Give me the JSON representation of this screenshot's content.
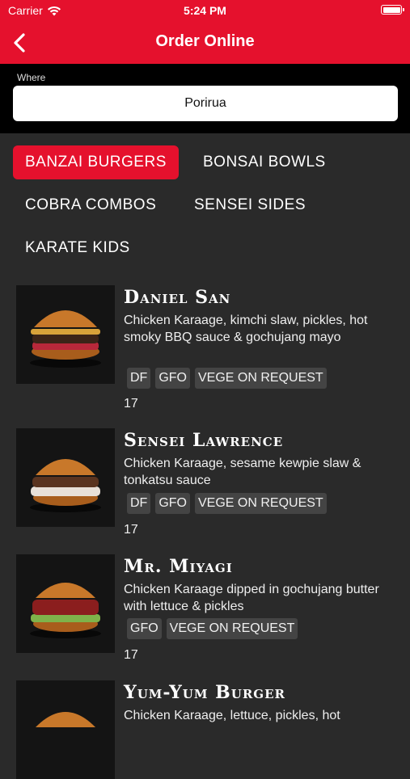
{
  "status_bar": {
    "carrier": "Carrier",
    "time": "5:24 PM"
  },
  "nav": {
    "title": "Order Online"
  },
  "location": {
    "label": "Where",
    "value": "Porirua"
  },
  "categories": [
    "BANZAI BURGERS",
    "BONSAI BOWLS",
    "COBRA COMBOS",
    "SENSEI SIDES",
    "KARATE KIDS"
  ],
  "active_category": "BANZAI BURGERS",
  "colors": {
    "accent": "#e5112d",
    "background": "#2a2a2a",
    "tag": "#444444"
  },
  "items": [
    {
      "name": "Daniel San",
      "description": "Chicken Karaage, kimchi slaw, pickles, hot smoky BBQ sauce & gochujang mayo",
      "tags": [
        "DF",
        "GFO",
        "VEGE ON REQUEST"
      ],
      "price": "17"
    },
    {
      "name": "Sensei Lawrence",
      "description": "Chicken Karaage, sesame kewpie slaw & tonkatsu sauce",
      "tags": [
        "DF",
        "GFO",
        "VEGE ON REQUEST"
      ],
      "price": "17"
    },
    {
      "name": "Mr. Miyagi",
      "description": "Chicken Karaage dipped in gochujang butter with lettuce & pickles",
      "tags": [
        "GFO",
        "VEGE ON REQUEST"
      ],
      "price": "17"
    },
    {
      "name": "Yum-Yum Burger",
      "description": "Chicken Karaage, lettuce, pickles, hot",
      "tags": [],
      "price": ""
    }
  ]
}
